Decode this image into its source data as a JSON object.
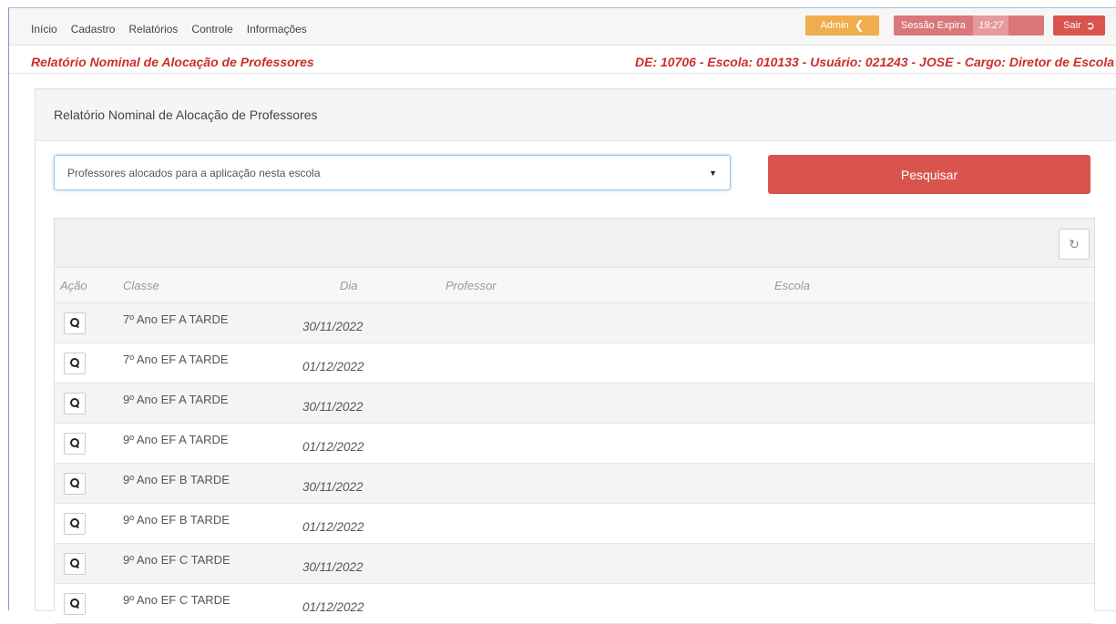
{
  "nav": {
    "menu": [
      "Início",
      "Cadastro",
      "Relatórios",
      "Controle",
      "Informações"
    ],
    "admin_label": "Admin",
    "session_label": "Sessão Expira",
    "session_time": "19:27",
    "logout_label": "Sair"
  },
  "subheader": {
    "title": "Relatório Nominal de Alocação de Professores",
    "info": "DE: 10706 - Escola: 010133 - Usuário: 021243 - JOSE - Cargo: Diretor de Escola"
  },
  "panel": {
    "title": "Relatório Nominal de Alocação de Professores",
    "select_value": "Professores alocados para a aplicação nesta escola",
    "search_label": "Pesquisar"
  },
  "table": {
    "headers": {
      "acao": "Ação",
      "classe": "Classe",
      "dia": "Dia",
      "professor": "Professor",
      "escola": "Escola"
    },
    "rows": [
      {
        "classe": "7º Ano EF A TARDE",
        "dia": "30/11/2022",
        "professor": "",
        "escola": ""
      },
      {
        "classe": "7º Ano EF A TARDE",
        "dia": "01/12/2022",
        "professor": "",
        "escola": ""
      },
      {
        "classe": "9º Ano EF A TARDE",
        "dia": "30/11/2022",
        "professor": "",
        "escola": ""
      },
      {
        "classe": "9º Ano EF A TARDE",
        "dia": "01/12/2022",
        "professor": "",
        "escola": ""
      },
      {
        "classe": "9º Ano EF B TARDE",
        "dia": "30/11/2022",
        "professor": "",
        "escola": ""
      },
      {
        "classe": "9º Ano EF B TARDE",
        "dia": "01/12/2022",
        "professor": "",
        "escola": ""
      },
      {
        "classe": "9º Ano EF C TARDE",
        "dia": "30/11/2022",
        "professor": "",
        "escola": ""
      },
      {
        "classe": "9º Ano EF C TARDE",
        "dia": "01/12/2022",
        "professor": "",
        "escola": ""
      }
    ]
  },
  "colors": {
    "danger": "#d9534f",
    "warning": "#f0ad4e",
    "title_red": "#c9302c"
  }
}
